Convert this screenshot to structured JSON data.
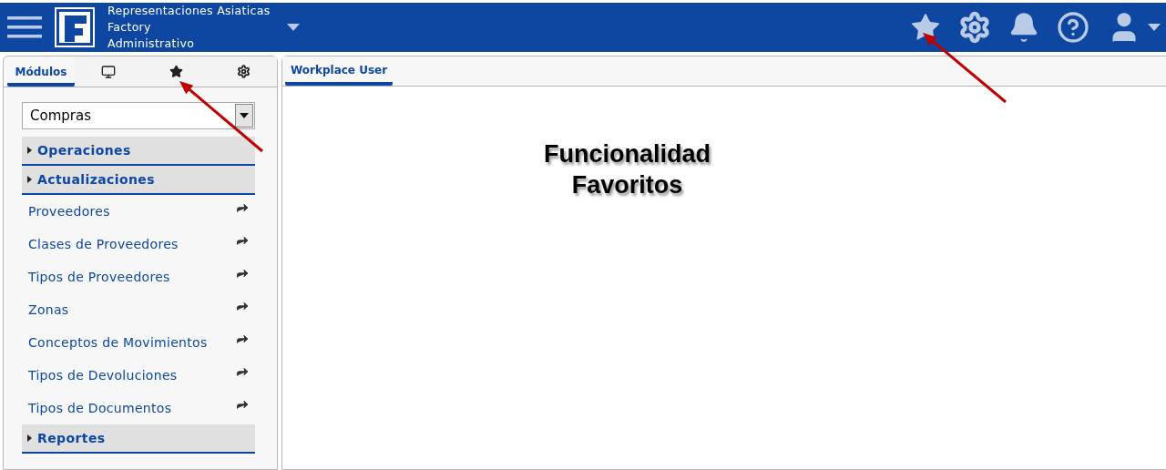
{
  "header": {
    "company": "Representaciones Asiaticas",
    "branch": "Factory",
    "role": "Administrativo"
  },
  "sidebar": {
    "tabs": [
      {
        "kind": "label",
        "label": "Módulos",
        "selected": true
      },
      {
        "kind": "monitor",
        "selected": false
      },
      {
        "kind": "star",
        "selected": false
      },
      {
        "kind": "gears",
        "selected": false
      }
    ],
    "module_select": {
      "value": "Compras"
    },
    "items": [
      {
        "kind": "section",
        "label": "Operaciones"
      },
      {
        "kind": "section",
        "label": "Actualizaciones"
      },
      {
        "kind": "link",
        "label": "Proveedores"
      },
      {
        "kind": "link",
        "label": "Clases de Proveedores"
      },
      {
        "kind": "link",
        "label": "Tipos de Proveedores"
      },
      {
        "kind": "link",
        "label": "Zonas"
      },
      {
        "kind": "link",
        "label": "Conceptos de Movimientos"
      },
      {
        "kind": "link",
        "label": "Tipos de Devoluciones"
      },
      {
        "kind": "link",
        "label": "Tipos de Documentos"
      },
      {
        "kind": "section",
        "label": "Reportes"
      }
    ]
  },
  "workspace": {
    "tabs": [
      {
        "label": "Workplace User",
        "selected": true
      }
    ],
    "annotation": [
      "Funcionalidad",
      "Favoritos"
    ]
  }
}
